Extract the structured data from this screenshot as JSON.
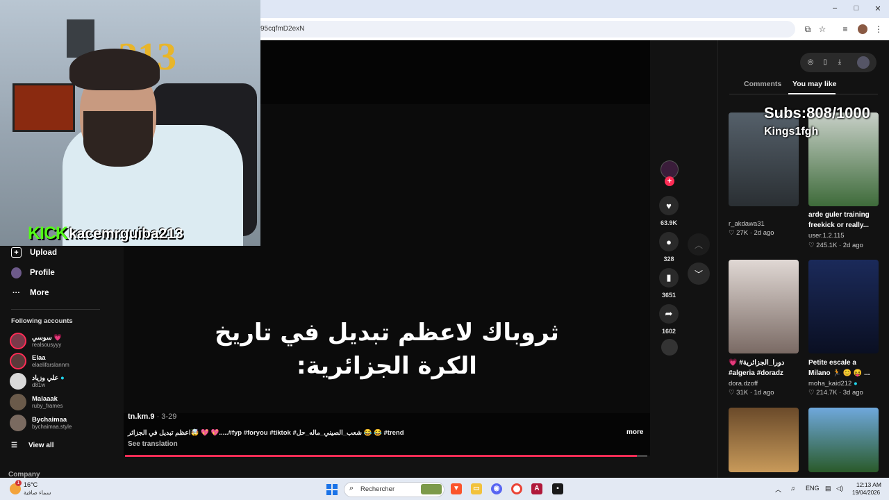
{
  "browser": {
    "url_fragment": "95cqfmD2exN",
    "window_controls": [
      "–",
      "□",
      "✕"
    ],
    "toolbar_icons": [
      "cast-icon",
      "star-icon",
      "media-icon",
      "profile-avatar",
      "menu-icon"
    ]
  },
  "stream_overlay": {
    "kick_label": "KICK",
    "channel": "kacemrguiba213",
    "subs_label": "Subs:808/1000",
    "sub_name": "Kings1fgh"
  },
  "sidebar": {
    "items": [
      {
        "label": "Upload",
        "icon": "⊕"
      },
      {
        "label": "Profile",
        "icon": "avatar"
      },
      {
        "label": "More",
        "icon": "···"
      }
    ],
    "following_title": "Following accounts",
    "accounts": [
      {
        "name": "سوسي 💗",
        "user": "realsousyyy"
      },
      {
        "name": "Elaa",
        "user": "elaelifarslannm"
      },
      {
        "name": "علي وزياد",
        "user": "d81w"
      },
      {
        "name": "Malaaak",
        "user": "ruby_frames"
      },
      {
        "name": "Bychaimaa",
        "user": "bychaimaa.style"
      }
    ],
    "view_all": "View all",
    "view_all_icon": "☰",
    "company": "Company"
  },
  "video": {
    "caption_line1": "ثروباك لاعظم تبديل في تاريخ",
    "caption_line2": "الكرة الجزائرية:",
    "author": "tn.km.9",
    "date": "· 3-29",
    "description": "اعظم تبديل في الجزائر🤯 💖 💖.....#fyp #foryou #tiktok #شعب_الصيني_ماله_حل 😂 😂 #trend",
    "more": "more",
    "see_translation": "See translation",
    "progress": 0.98
  },
  "actions": {
    "likes": "63.9K",
    "comments": "328",
    "saves": "3651",
    "shares": "1602"
  },
  "right_panel": {
    "tabs": [
      "Comments",
      "You may like"
    ],
    "active_tab": "You may like",
    "cards": [
      {
        "title": "",
        "user": "r_akdawa31",
        "likes": "27K",
        "age": "2d ago"
      },
      {
        "title": "arde guler training freekick or really...",
        "user": "user.1.2.115",
        "likes": "245.1K",
        "age": "2d ago"
      },
      {
        "title": "💗 #دورا_الجزائرية #algeria #doradz",
        "user": "dora.dzoff",
        "likes": "31K",
        "age": "1d ago"
      },
      {
        "title": "Petite escale a Milano 🏃 😊 😝 ...",
        "user": "moha_kaid212",
        "likes": "214.7K",
        "age": "3d ago"
      }
    ]
  },
  "taskbar": {
    "weather_temp": "16°C",
    "weather_condition": "سماء صافية",
    "weather_badge": "1",
    "search_placeholder": "Rechercher",
    "language": "ENG",
    "time": "12:13 AM",
    "date": "19/04/2026"
  },
  "colors": {
    "accent": "#fe2c55",
    "kick_green": "#53fc18",
    "background": "#121212"
  }
}
